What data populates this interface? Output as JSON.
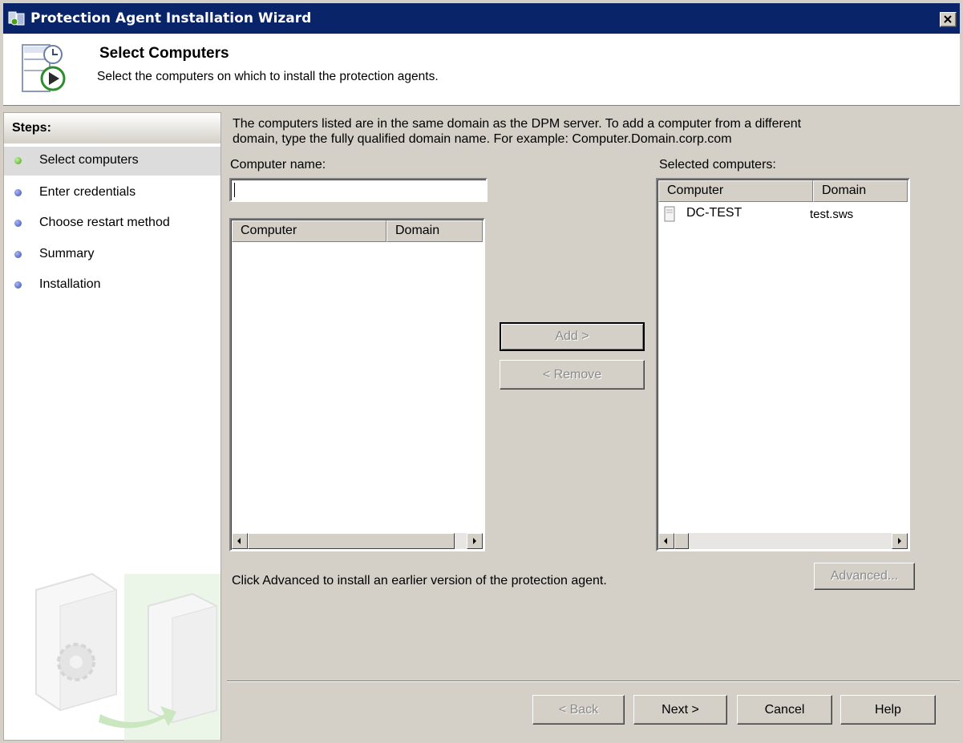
{
  "window": {
    "title": "Protection Agent Installation Wizard"
  },
  "header": {
    "title": "Select Computers",
    "subtitle": "Select the computers on which to install the protection agents."
  },
  "steps": {
    "heading": "Steps:",
    "items": [
      {
        "label": "Select computers",
        "selected": true
      },
      {
        "label": "Enter credentials"
      },
      {
        "label": "Choose restart method"
      },
      {
        "label": "Summary"
      },
      {
        "label": "Installation"
      }
    ]
  },
  "main": {
    "description_line1": "The computers listed are in the same domain as the DPM server. To add a computer from a different",
    "description_line2": "domain, type the fully qualified domain name. For example: Computer.Domain.corp.com",
    "computer_name_label": "Computer name:",
    "computer_name_value": "",
    "available_list": {
      "columns": [
        "Computer",
        "Domain"
      ],
      "rows": []
    },
    "selected_label": "Selected computers:",
    "selected_list": {
      "columns": [
        "Computer",
        "Domain"
      ],
      "rows": [
        {
          "computer": "DC-TEST",
          "domain": "test.sws"
        }
      ]
    },
    "add_button": "Add >",
    "remove_button": "< Remove",
    "advanced_hint": "Click Advanced to install an earlier version of the protection agent.",
    "advanced_button": "Advanced..."
  },
  "footer": {
    "back_button": "< Back",
    "next_button": "Next >",
    "cancel_button": "Cancel",
    "help_button": "Help"
  },
  "colors": {
    "titlebar": "#0a246a",
    "face": "#d4d0c8",
    "selected_step": "#dcdcdc"
  }
}
